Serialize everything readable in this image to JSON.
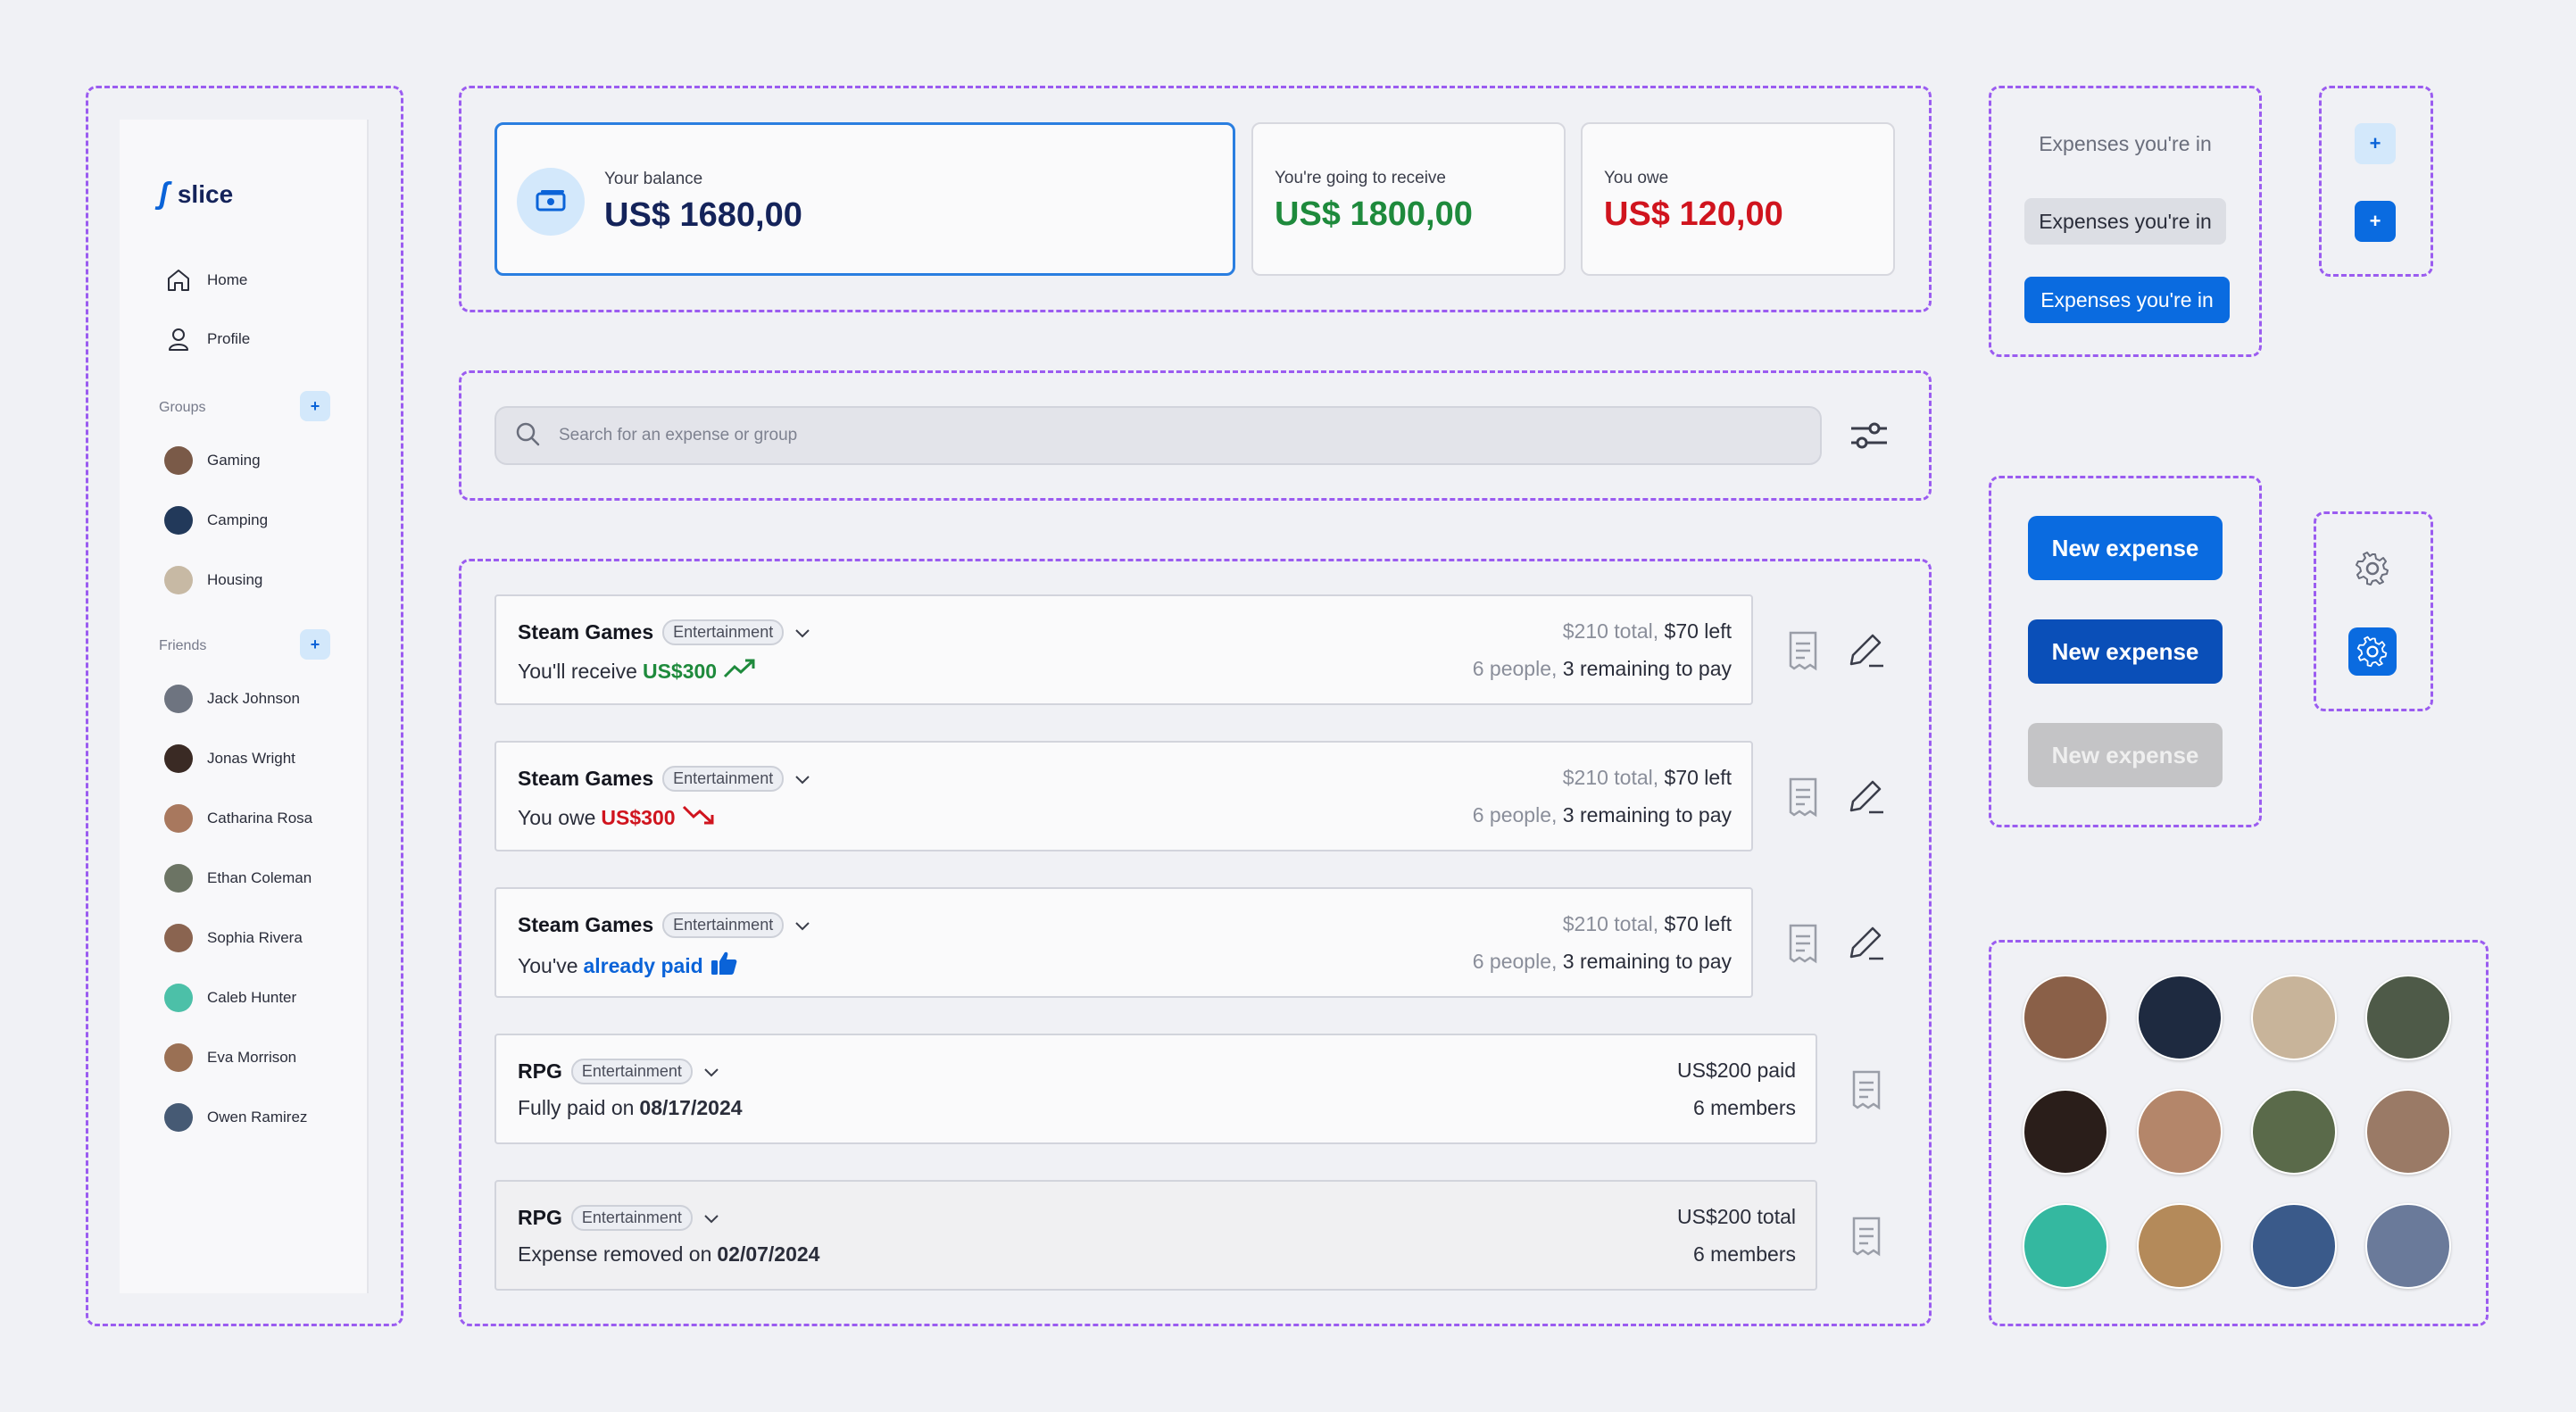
{
  "sidebar": {
    "logo_mark": "ʃ",
    "logo_text": "slice",
    "nav": [
      {
        "label": "Home"
      },
      {
        "label": "Profile"
      }
    ],
    "groups_title": "Groups",
    "groups_add": "+",
    "groups": [
      {
        "label": "Gaming",
        "color": "#7a5a48"
      },
      {
        "label": "Camping",
        "color": "#22395a"
      },
      {
        "label": "Housing",
        "color": "#c7b9a4"
      }
    ],
    "friends_title": "Friends",
    "friends_add": "+",
    "friends": [
      {
        "label": "Jack Johnson",
        "color": "#6e7480"
      },
      {
        "label": "Jonas Wright",
        "color": "#3a2a24"
      },
      {
        "label": "Catharina Rosa",
        "color": "#a8785e"
      },
      {
        "label": "Ethan Coleman",
        "color": "#6c7464"
      },
      {
        "label": "Sophia Rivera",
        "color": "#8a6450"
      },
      {
        "label": "Caleb Hunter",
        "color": "#4cc0a8"
      },
      {
        "label": "Eva Morrison",
        "color": "#9a7054"
      },
      {
        "label": "Owen Ramirez",
        "color": "#465a74"
      }
    ]
  },
  "balances": {
    "main": {
      "label": "Your balance",
      "value": "US$ 1680,00"
    },
    "receive": {
      "label": "You're going to receive",
      "value": "US$ 1800,00"
    },
    "owe": {
      "label": "You owe",
      "value": "US$ 120,00"
    }
  },
  "search": {
    "placeholder": "Search for an expense or group"
  },
  "expenses": [
    {
      "name": "Steam Games",
      "tag": "Entertainment",
      "sub_prefix": "You'll receive ",
      "sub_value": "US$300",
      "r1_a": "$210 total, ",
      "r1_b": "$70 left",
      "r2_a": "6 people, ",
      "r2_b": "3 remaining to pay"
    },
    {
      "name": "Steam Games",
      "tag": "Entertainment",
      "sub_prefix": "You owe ",
      "sub_value": "US$300",
      "r1_a": "$210 total, ",
      "r1_b": "$70 left",
      "r2_a": "6 people, ",
      "r2_b": "3 remaining to pay"
    },
    {
      "name": "Steam Games",
      "tag": "Entertainment",
      "sub_prefix": "You've ",
      "sub_value": "already paid",
      "r1_a": "$210 total, ",
      "r1_b": "$70 left",
      "r2_a": "6 people, ",
      "r2_b": "3 remaining to pay"
    },
    {
      "name": "RPG",
      "tag": "Entertainment",
      "sub_prefix": "Fully paid on ",
      "sub_value": "08/17/2024",
      "r1": "US$200 paid",
      "r2": "6 members"
    },
    {
      "name": "RPG",
      "tag": "Entertainment",
      "sub_prefix": "Expense removed on ",
      "sub_value": "02/07/2024",
      "r1": "US$200 total",
      "r2": "6 members"
    }
  ],
  "chips": {
    "plain": "Expenses you're in",
    "grey": "Expenses you're in",
    "blue": "Expenses you're in"
  },
  "small_buttons": {
    "plus_a": "+",
    "plus_b": "+"
  },
  "new_expense": {
    "normal": "New expense",
    "hover": "New expense",
    "disabled": "New expense"
  },
  "colors": {
    "primary": "#0a63d8",
    "pressed": "#0a4fb8",
    "disabled": "#c4c4c6",
    "positive": "#1e8a3c",
    "negative": "#d0141e",
    "dash": "#9b5cf0"
  },
  "photos": [
    {
      "color": "#8a6048"
    },
    {
      "color": "#1e2a40"
    },
    {
      "color": "#c8b49a"
    },
    {
      "color": "#4e5a48"
    },
    {
      "color": "#2a1e1a"
    },
    {
      "color": "#b4866a"
    },
    {
      "color": "#5a6a4a"
    },
    {
      "color": "#9a7a66"
    },
    {
      "color": "#34b8a0"
    },
    {
      "color": "#b48a5a"
    },
    {
      "color": "#3a5a8a"
    },
    {
      "color": "#6a7a9a"
    }
  ]
}
